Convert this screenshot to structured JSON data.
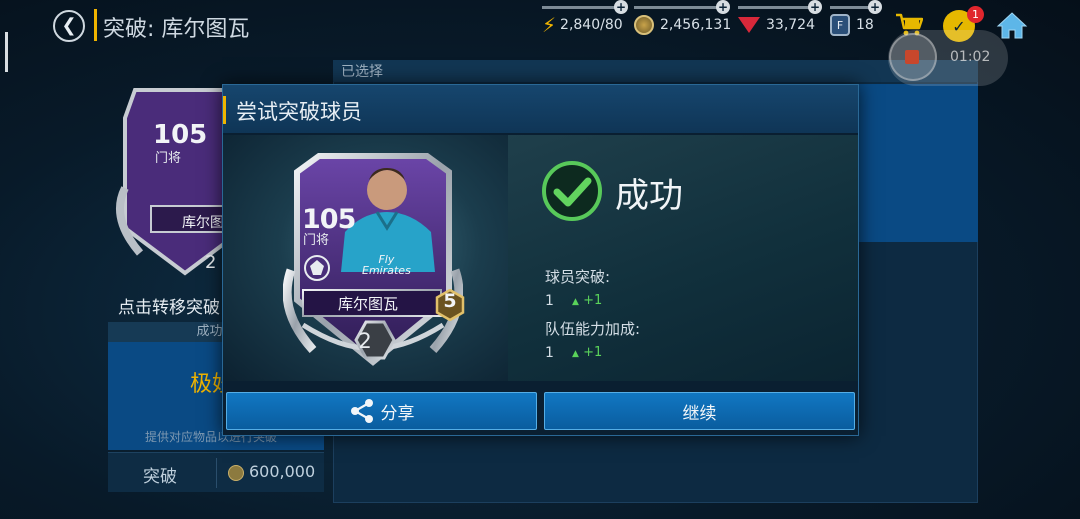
{
  "header": {
    "title": "突破: 库尔图瓦",
    "stamina": "2,840/80",
    "coins": "2,456,131",
    "gems": "33,724",
    "fifa_points": "18",
    "tasks_badge": "1",
    "recording_time": "01:02",
    "colors": {
      "accent": "#f0b400",
      "panel": "#0a4a84"
    }
  },
  "background": {
    "selected_label": "已选择",
    "prompt": "点击转移突破",
    "strip_label": "成功机",
    "rarity_label": "极妙",
    "hint": "提供对应物品以进行突破",
    "breakthrough_label": "突破",
    "breakthrough_cost": "600,000"
  },
  "dialog": {
    "title": "尝试突破球员",
    "result": "成功",
    "player_breakthrough_label": "球员突破:",
    "player_breakthrough_value": "1",
    "player_breakthrough_change": "+1",
    "team_power_label": "队伍能力加成:",
    "team_power_value": "1",
    "team_power_change": "+1",
    "share_label": "分享",
    "continue_label": "继续"
  },
  "card": {
    "rating": "105",
    "position": "门将",
    "name": "库尔图瓦",
    "sponsor_line1": "Fly",
    "sponsor_line2": "Emirates",
    "level": "5",
    "rank": "2"
  },
  "icons": [
    "back-icon",
    "bolt-icon",
    "coin-icon",
    "gem-icon",
    "fifa-points-icon",
    "cart-icon",
    "tasks-icon",
    "home-icon",
    "check-icon",
    "share-icon"
  ]
}
